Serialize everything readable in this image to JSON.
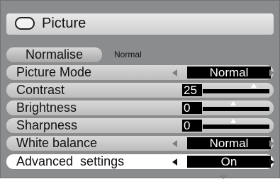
{
  "header": {
    "title": "Picture",
    "icon": "pill-icon"
  },
  "normalise": {
    "button_label": "Normalise",
    "value": "Normal"
  },
  "rows": [
    {
      "label": "Picture Mode",
      "value": "Normal"
    },
    {
      "label": "Contrast",
      "value": "25"
    },
    {
      "label": "Brightness",
      "value": "0"
    },
    {
      "label": "Sharpness",
      "value": "0"
    },
    {
      "label": "White balance",
      "value": "Normal"
    },
    {
      "label": "Advanced  settings",
      "value": "On"
    }
  ],
  "colors": {
    "panel": "#8a8c8e",
    "row": "#cfcfcf",
    "value_bg": "#000000",
    "selected_row": "#ffffff"
  }
}
